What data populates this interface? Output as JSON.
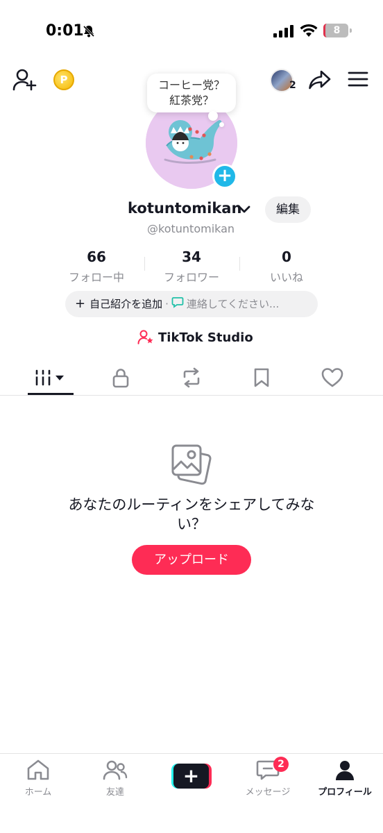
{
  "status_bar": {
    "time": "0:01",
    "battery": "8"
  },
  "profile": {
    "bubble_line1": "コーヒー党？",
    "bubble_line2": "紅茶党？",
    "username": "kotuntomikan",
    "handle": "@kotuntomikan",
    "edit_label": "編集",
    "story_count": "2",
    "coin_letter": "P"
  },
  "stats": [
    {
      "value": "66",
      "label": "フォロー中"
    },
    {
      "value": "34",
      "label": "フォロワー"
    },
    {
      "value": "0",
      "label": "いいね"
    }
  ],
  "bio": {
    "add_label": "自己紹介を追加",
    "contact_label": "連絡してください..."
  },
  "studio_label": "TikTok Studio",
  "tabs": [
    "videos",
    "private",
    "reposts",
    "favorites",
    "liked"
  ],
  "empty_state": {
    "text": "あなたのルーティンをシェアしてみない？",
    "button": "アップロード"
  },
  "bottom_nav": {
    "home": "ホーム",
    "friends": "友達",
    "messages": "メッセージ",
    "messages_badge": "2",
    "profile": "プロフィール"
  },
  "colors": {
    "accent": "#fe2c55",
    "cyan": "#25f4ee",
    "avatar_bg": "#e9c9f0"
  }
}
